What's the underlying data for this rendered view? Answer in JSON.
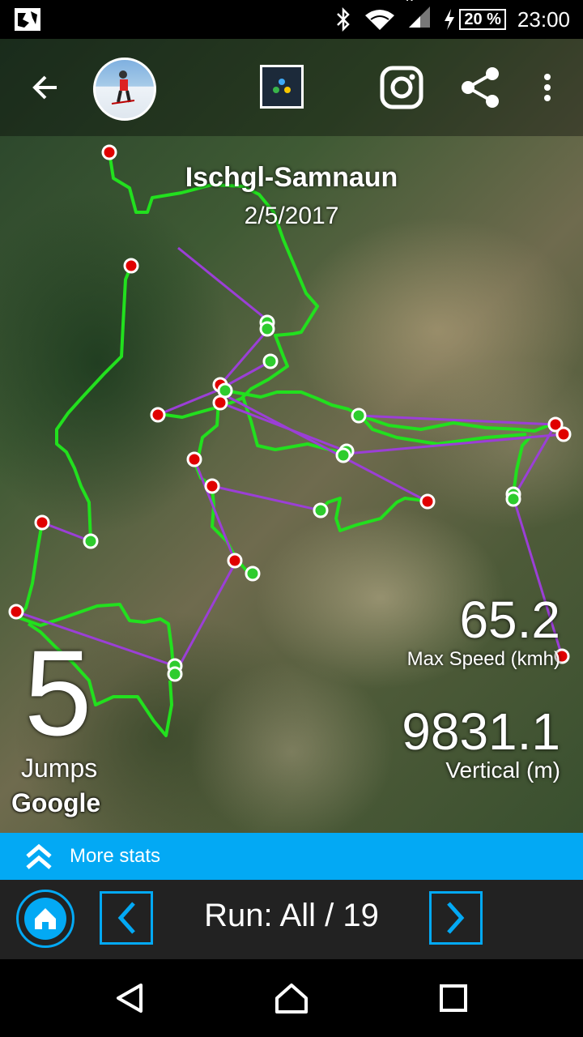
{
  "status_bar": {
    "time": "23:00",
    "battery": "20 %",
    "signal_badge": "R"
  },
  "map": {
    "resort_name": "Ischgl-Samnaun",
    "date": "2/5/2017",
    "attribution": "Google"
  },
  "stats": {
    "jumps_value": "5",
    "jumps_label": "Jumps",
    "max_speed_value": "65.2",
    "max_speed_label": "Max Speed (kmh)",
    "vertical_value": "9831.1",
    "vertical_label": "Vertical (m)"
  },
  "more_stats_label": "More stats",
  "run_label": "Run: All / 19",
  "colors": {
    "accent": "#03a9f4",
    "run_track": "#22e01e",
    "lift_line": "#9b3fd6",
    "start_marker": "#e00000",
    "end_marker": "#2ecc2e"
  },
  "icons": [
    "back-arrow-icon",
    "app-logo-icon",
    "instagram-icon",
    "share-icon",
    "more-vert-icon",
    "double-chevron-up-icon",
    "home-icon",
    "chevron-left-icon",
    "chevron-right-icon"
  ]
}
